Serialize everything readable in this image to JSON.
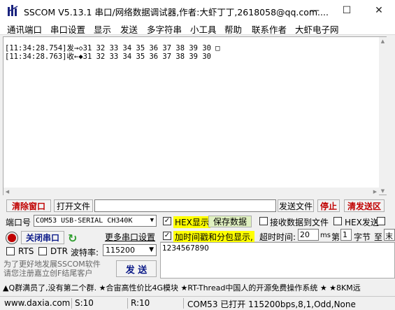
{
  "window": {
    "title": "SSCOM V5.13.1 串口/网络数据调试器,作者:大虾丁丁,2618058@qq.com...."
  },
  "menu": [
    "通讯端口",
    "串口设置",
    "显示",
    "发送",
    "多字符串",
    "小工具",
    "帮助",
    "联系作者",
    "大虾电子网"
  ],
  "output": {
    "lines": [
      "[11:34:28.754]发→◇31 32 33 34 35 36 37 38 39 30 □",
      "[11:34:28.763]收←◆31 32 33 34 35 36 37 38 39 30"
    ]
  },
  "toolbar": {
    "clear_window": "清除窗口",
    "open_file": "打开文件",
    "file_path": "",
    "send_file": "发送文件",
    "stop": "停止",
    "clear_send": "清发送区"
  },
  "port": {
    "label": "端口号",
    "value": "COM53 USB-SERIAL CH340K",
    "close_button": "关闭串口",
    "more_settings": "更多串口设置",
    "rts_label": "RTS",
    "dtr_label": "DTR",
    "baud_label": "波特率:",
    "baud_value": "115200"
  },
  "options": {
    "hex_display": "HEX显示",
    "hex_display_checked": true,
    "save_data": "保存数据",
    "recv_to_file": "接收数据到文件",
    "recv_to_file_checked": false,
    "hex_send": "HEX发送",
    "hex_send_checked": false,
    "timestamp": "加时间戳和分包显示,",
    "timestamp_checked": true,
    "timeout_label": "超时时间:",
    "timeout_value": "20",
    "timeout_unit": "ms",
    "nth_label": "第",
    "nth_value": "1",
    "byte_label": "字节",
    "to_label": "至",
    "to_value": "末"
  },
  "send": {
    "text": "1234567890",
    "button": "发 送"
  },
  "promo": {
    "text": "为了更好地发展SSCOM软件\n请您注册嘉立创F结尾客户"
  },
  "ticker": {
    "text": "▲Q群满员了,没有第二个群. ★合宙高性价比4G模块 ★RT-Thread中国人的开源免费操作系统 ★ ★8KM远"
  },
  "statusbar": {
    "website": "www.daxia.com",
    "sent": "S:10",
    "received": "R:10",
    "port_status": "COM53 已打开  115200bps,8,1,Odd,None"
  },
  "colors": {
    "highlight_yellow": "#ffff00",
    "save_green": "#dff0c0",
    "status_red": "#c00000",
    "icon_blue": "#1a237e"
  }
}
